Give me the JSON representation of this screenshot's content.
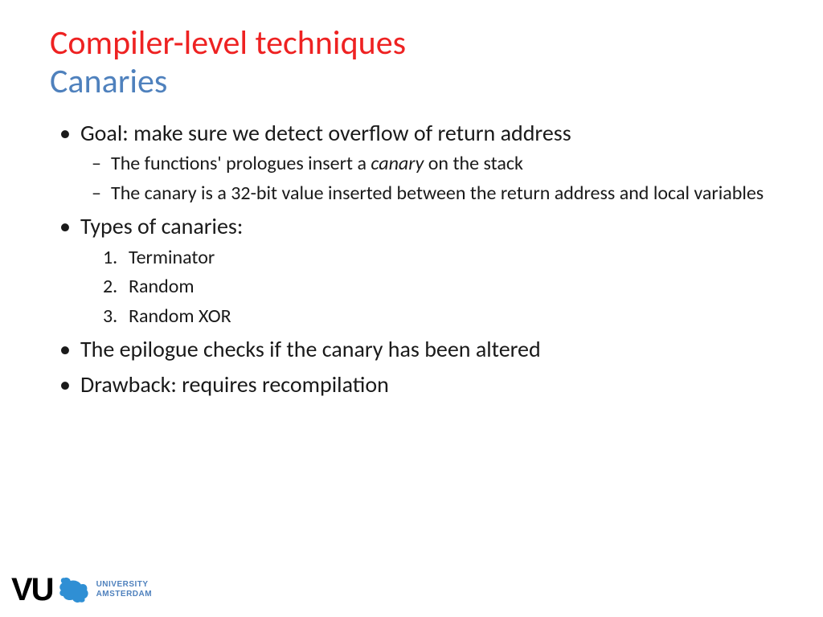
{
  "slide": {
    "title": "Compiler-level techniques",
    "subtitle": "Canaries",
    "bullet1": "Goal: make sure we detect overflow of return address",
    "bullet1_sub1_a": "The functions' prologues insert a ",
    "bullet1_sub1_em": "canary",
    "bullet1_sub1_b": " on the stack",
    "bullet1_sub2": "The canary is a 32-bit value inserted between the return address and local variables",
    "bullet2": "Types of canaries:",
    "bullet2_num1": "Terminator",
    "bullet2_num2": "Random",
    "bullet2_num3": "Random XOR",
    "bullet3": "The epilogue checks if the canary has been altered",
    "bullet4": "Drawback: requires recompilation"
  },
  "logo": {
    "letters": "VU",
    "uni_line1": "UNIVERSITY",
    "uni_line2": "AMSTERDAM"
  }
}
